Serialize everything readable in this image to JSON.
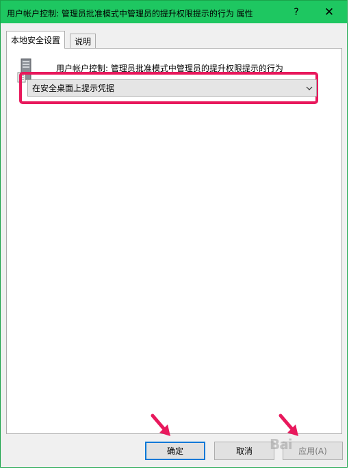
{
  "window": {
    "title": "用户帐户控制: 管理员批准模式中管理员的提升权限提示的行为 属性",
    "help_label": "?",
    "close_label": "✕"
  },
  "tabs": [
    {
      "label": "本地安全设置",
      "active": true
    },
    {
      "label": "说明",
      "active": false
    }
  ],
  "policy": {
    "icon": "server-icon",
    "title": "用户帐户控制: 管理员批准模式中管理员的提升权限提示的行为"
  },
  "dropdown": {
    "selected": "在安全桌面上提示凭据",
    "arrow_icon": "chevron-down-icon"
  },
  "buttons": {
    "ok": "确定",
    "cancel": "取消",
    "apply": "应用(A)"
  },
  "watermark": "Bai",
  "colors": {
    "titlebar": "#1ec761",
    "highlight": "#e8185c",
    "arrow": "#e8185c",
    "focus": "#0078d7"
  }
}
